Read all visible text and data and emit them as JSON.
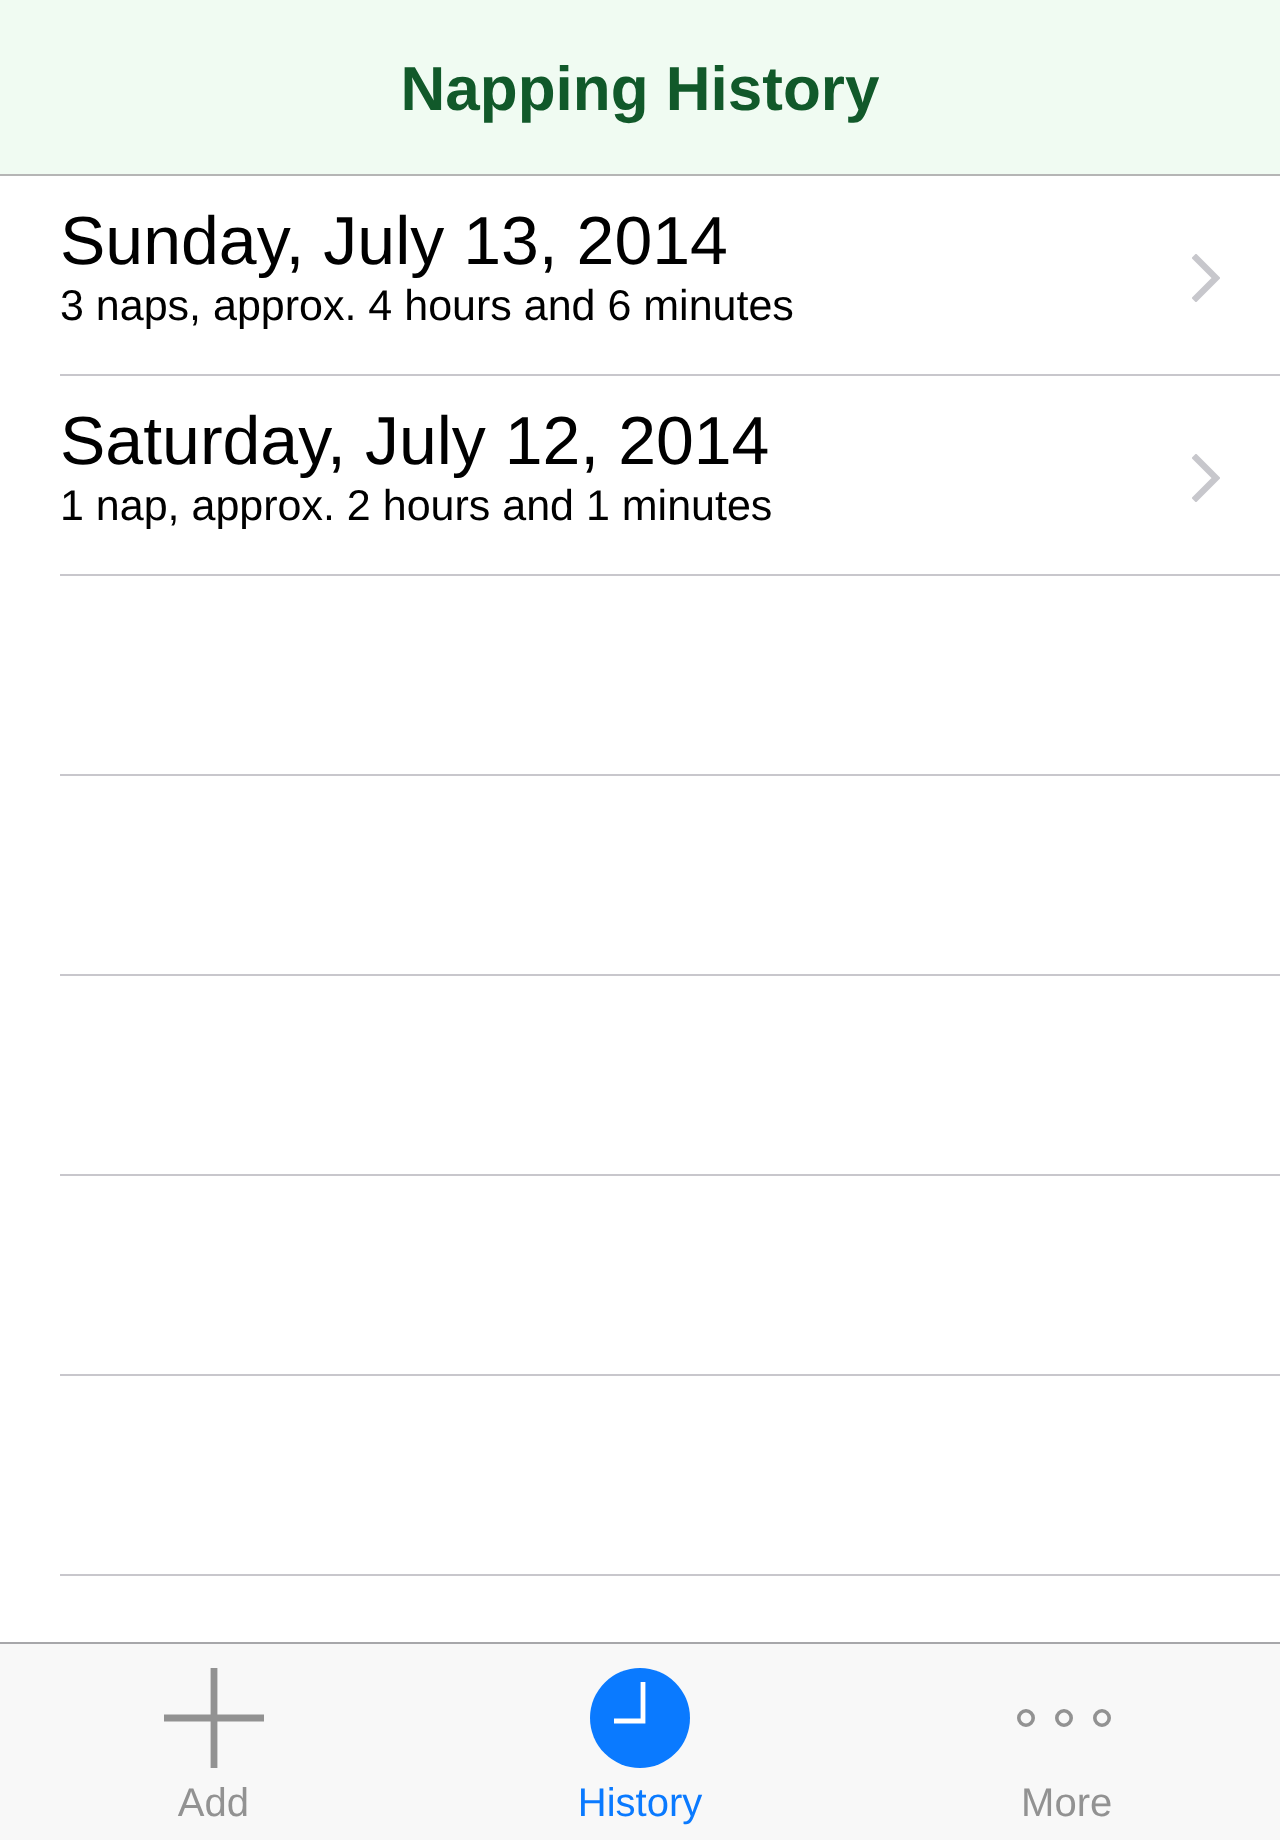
{
  "header": {
    "title": "Napping History"
  },
  "days": [
    {
      "date": "Sunday, July 13, 2014",
      "summary": "3 naps, approx. 4 hours and 6 minutes"
    },
    {
      "date": "Saturday, July 12, 2014",
      "summary": "1 nap, approx. 2 hours and 1 minutes"
    }
  ],
  "tab_bar": {
    "tabs": [
      {
        "label": "Add",
        "kind": "add",
        "selected": false
      },
      {
        "label": "History",
        "kind": "history",
        "selected": true
      },
      {
        "label": "More",
        "kind": "more",
        "selected": false
      }
    ]
  }
}
